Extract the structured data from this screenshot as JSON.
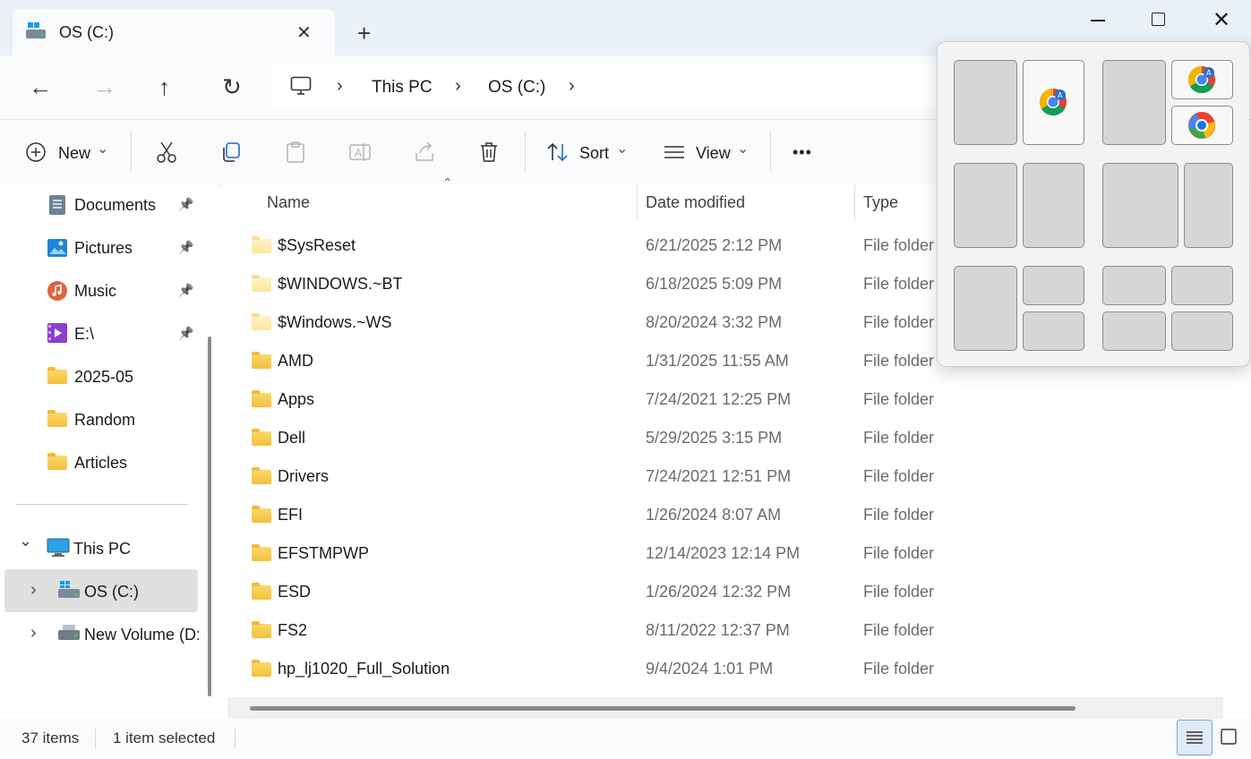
{
  "window": {
    "tab_title": "OS (C:)",
    "tab_close": "✕",
    "tab_add": "+",
    "win_close": "✕"
  },
  "nav": {
    "back": "←",
    "forward": "→",
    "up": "↑",
    "refresh": "↻"
  },
  "breadcrumb": {
    "items": [
      "This PC",
      "OS (C:)"
    ],
    "chevron": "›"
  },
  "toolbar": {
    "new_label": "New",
    "sort_label": "Sort",
    "view_label": "View",
    "more_label": "•••",
    "dropdown": "⌄"
  },
  "sidebar": {
    "items": [
      {
        "label": "Documents",
        "icon": "documents-icon",
        "pinned": true
      },
      {
        "label": "Pictures",
        "icon": "pictures-icon",
        "pinned": true
      },
      {
        "label": "Music",
        "icon": "music-icon",
        "pinned": true
      },
      {
        "label": "E:\\",
        "icon": "videos-icon",
        "pinned": true
      },
      {
        "label": "2025-05",
        "icon": "folder-icon"
      },
      {
        "label": "Random",
        "icon": "folder-icon"
      },
      {
        "label": "Articles",
        "icon": "folder-icon"
      }
    ],
    "tree": [
      {
        "label": "This PC",
        "icon": "monitor-icon",
        "expanded": true
      },
      {
        "label": "OS (C:)",
        "icon": "windows-drive-icon",
        "selected": true
      },
      {
        "label": "New Volume (D:",
        "icon": "drive-icon"
      }
    ],
    "pin_glyph": "📌",
    "expand_glyph": "›",
    "collapse_glyph": "⌄"
  },
  "columns": {
    "name": "Name",
    "date": "Date modified",
    "type": "Type",
    "sort_indicator": "⌃"
  },
  "files": [
    {
      "name": "$SysReset",
      "date": "6/21/2025 2:12 PM",
      "type": "File folder",
      "hidden": true
    },
    {
      "name": "$WINDOWS.~BT",
      "date": "6/18/2025 5:09 PM",
      "type": "File folder",
      "hidden": true
    },
    {
      "name": "$Windows.~WS",
      "date": "8/20/2024 3:32 PM",
      "type": "File folder",
      "hidden": true
    },
    {
      "name": "AMD",
      "date": "1/31/2025 11:55 AM",
      "type": "File folder"
    },
    {
      "name": "Apps",
      "date": "7/24/2021 12:25 PM",
      "type": "File folder"
    },
    {
      "name": "Dell",
      "date": "5/29/2025 3:15 PM",
      "type": "File folder"
    },
    {
      "name": "Drivers",
      "date": "7/24/2021 12:51 PM",
      "type": "File folder"
    },
    {
      "name": "EFI",
      "date": "1/26/2024 8:07 AM",
      "type": "File folder"
    },
    {
      "name": "EFSTMPWP",
      "date": "12/14/2023 12:14 PM",
      "type": "File folder"
    },
    {
      "name": "ESD",
      "date": "1/26/2024 12:32 PM",
      "type": "File folder"
    },
    {
      "name": "FS2",
      "date": "8/11/2022 12:37 PM",
      "type": "File folder"
    },
    {
      "name": "hp_lj1020_Full_Solution",
      "date": "9/4/2024 1:01 PM",
      "type": "File folder"
    }
  ],
  "status": {
    "items_count": "37 items",
    "selection": "1 item selected"
  },
  "snap_layouts": {
    "occupied_apps": [
      "chrome-icon",
      "chrome-icon",
      "edge-icon"
    ]
  }
}
